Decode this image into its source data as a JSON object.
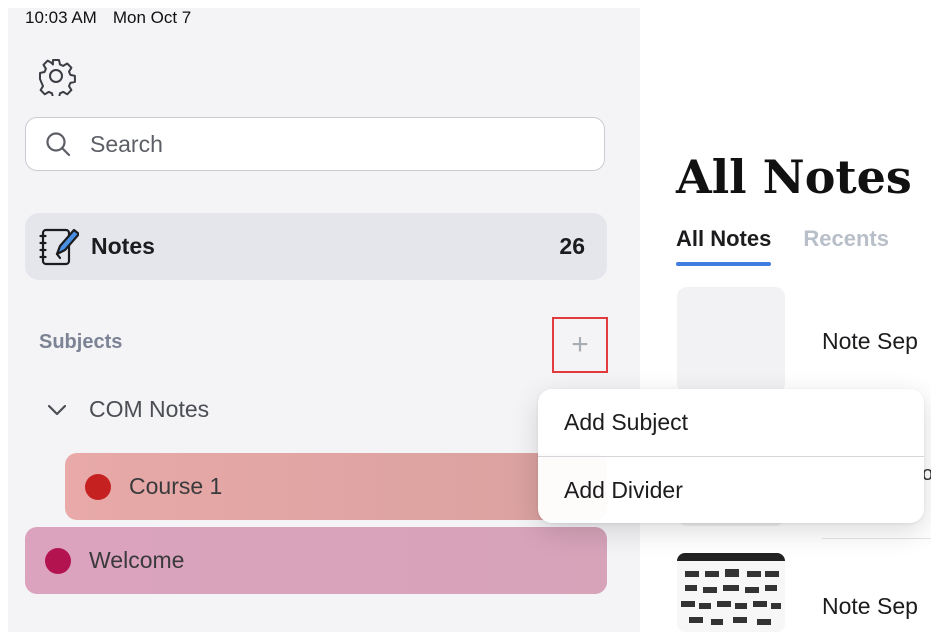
{
  "status_bar": {
    "time": "10:03 AM",
    "date": "Mon Oct 7"
  },
  "sidebar": {
    "search": {
      "placeholder": "Search"
    },
    "notes": {
      "label": "Notes",
      "count": "26"
    },
    "subjects": {
      "label": "Subjects",
      "add_symbol": "+",
      "groups": [
        {
          "name": "COM Notes",
          "expanded": true,
          "children": [
            {
              "name": "Course 1",
              "color": "#c62121"
            }
          ]
        }
      ],
      "items": [
        {
          "name": "Welcome",
          "color": "#b3134e"
        }
      ]
    }
  },
  "main": {
    "title": "All Notes",
    "tabs": [
      {
        "label": "All Notes",
        "active": true
      },
      {
        "label": "Recents",
        "active": false
      }
    ],
    "notes": [
      {
        "title": "Note Sep"
      },
      {
        "title": "Note Sep"
      }
    ],
    "edge_text": "o"
  },
  "context_menu": {
    "items": [
      {
        "label": "Add Subject"
      },
      {
        "label": "Add Divider"
      }
    ]
  },
  "colors": {
    "accent": "#3f7de0",
    "highlight_border": "#e23b3b"
  }
}
